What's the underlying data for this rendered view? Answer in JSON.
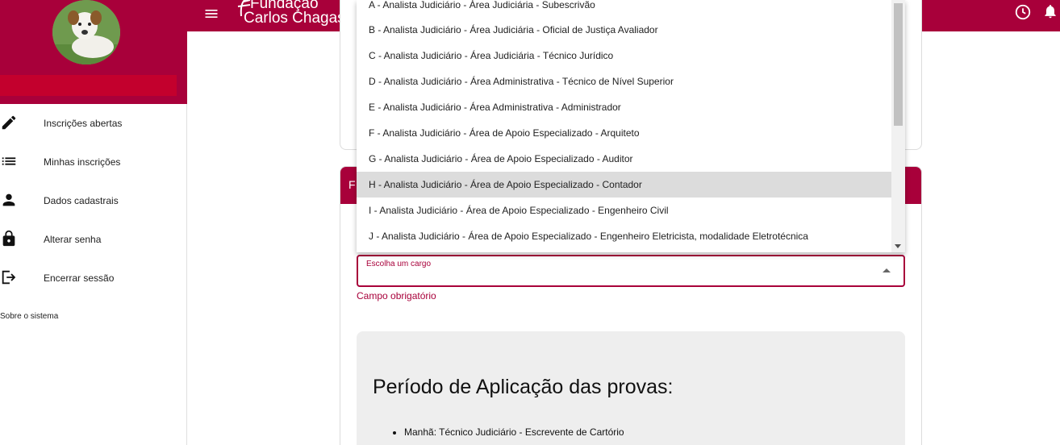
{
  "app": {
    "logo_line1": "Fundação",
    "logo_line2": "Carlos Chagas",
    "brand_color": "#a8003a"
  },
  "sidebar": {
    "items": [
      {
        "label": "Inscrições abertas",
        "icon": "pencil-icon"
      },
      {
        "label": "Minhas inscrições",
        "icon": "list-icon"
      },
      {
        "label": "Dados cadastrais",
        "icon": "person-icon"
      },
      {
        "label": "Alterar senha",
        "icon": "lock-icon"
      },
      {
        "label": "Encerrar sessão",
        "icon": "logout-icon"
      }
    ],
    "about": "Sobre o sistema"
  },
  "form": {
    "card_header": "F",
    "select_label": "Escolha um cargo",
    "select_value": "",
    "hint": "Campo obrigatório"
  },
  "dropdown": {
    "options": [
      "A - Analista Judiciário - Área Judiciária - Subescrivão",
      "B - Analista Judiciário - Área Judiciária - Oficial de Justiça Avaliador",
      "C - Analista Judiciário - Área Judiciária - Técnico Jurídico",
      "D - Analista Judiciário - Área Administrativa - Técnico de Nível Superior",
      "E - Analista Judiciário - Área Administrativa - Administrador",
      "F - Analista Judiciário - Área de Apoio Especializado - Arquiteto",
      "G - Analista Judiciário - Área de Apoio Especializado - Auditor",
      "H - Analista Judiciário - Área de Apoio Especializado - Contador",
      "I - Analista Judiciário - Área de Apoio Especializado - Engenheiro Civil",
      "J - Analista Judiciário - Área de Apoio Especializado - Engenheiro Eletricista, modalidade Eletrotécnica"
    ],
    "highlighted_index": 7
  },
  "info": {
    "title": "Período de Aplicação das provas:",
    "items": [
      {
        "label": "Manhã:",
        "text": "Técnico Judiciário - Escrevente de Cartório"
      }
    ]
  }
}
